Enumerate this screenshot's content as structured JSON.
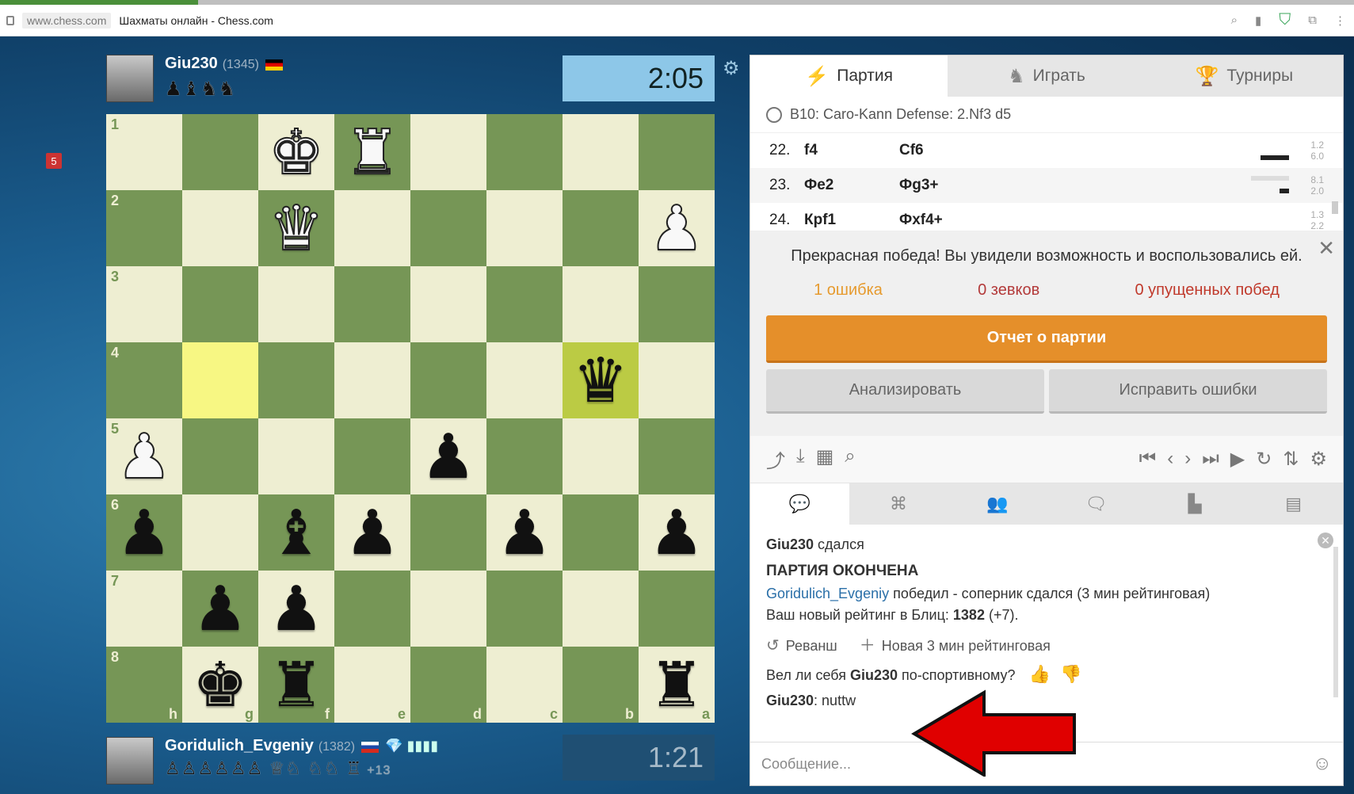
{
  "browser": {
    "host": "www.chess.com",
    "title": "Шахматы онлайн - Chess.com"
  },
  "top_player": {
    "name": "Giu230",
    "rating": "(1345)",
    "captured": "♟♝♞♞"
  },
  "bottom_player": {
    "name": "Goridulich_Evgeniy",
    "rating": "(1382)",
    "badges": "💎 ▮▮▮▮",
    "captured": "♙♙♙♙♙♙ ♕♘ ♘♘ ♖",
    "advantage": "+13"
  },
  "clocks": {
    "top": "2:05",
    "bottom": "1:21"
  },
  "sidebar_badge": "5",
  "board": {
    "ranks": [
      "1",
      "2",
      "3",
      "4",
      "5",
      "6",
      "7",
      "8"
    ],
    "files": [
      "h",
      "g",
      "f",
      "e",
      "d",
      "c",
      "b",
      "a"
    ],
    "pieces": [
      {
        "rank": 1,
        "col": 2,
        "glyph": "♚",
        "color": "w",
        "name": "white-king"
      },
      {
        "rank": 1,
        "col": 3,
        "glyph": "♜",
        "color": "w",
        "name": "white-rook"
      },
      {
        "rank": 2,
        "col": 2,
        "glyph": "♛",
        "color": "w",
        "name": "white-queen"
      },
      {
        "rank": 2,
        "col": 7,
        "glyph": "♟",
        "color": "w",
        "name": "white-pawn"
      },
      {
        "rank": 4,
        "col": 6,
        "glyph": "♛",
        "color": "b",
        "name": "black-queen"
      },
      {
        "rank": 5,
        "col": 0,
        "glyph": "♟",
        "color": "w",
        "name": "white-pawn"
      },
      {
        "rank": 5,
        "col": 4,
        "glyph": "♟",
        "color": "b",
        "name": "black-pawn"
      },
      {
        "rank": 6,
        "col": 0,
        "glyph": "♟",
        "color": "b",
        "name": "black-pawn"
      },
      {
        "rank": 6,
        "col": 2,
        "glyph": "♝",
        "color": "b",
        "name": "black-bishop"
      },
      {
        "rank": 6,
        "col": 3,
        "glyph": "♟",
        "color": "b",
        "name": "black-pawn"
      },
      {
        "rank": 6,
        "col": 5,
        "glyph": "♟",
        "color": "b",
        "name": "black-pawn"
      },
      {
        "rank": 6,
        "col": 7,
        "glyph": "♟",
        "color": "b",
        "name": "black-pawn"
      },
      {
        "rank": 7,
        "col": 1,
        "glyph": "♟",
        "color": "b",
        "name": "black-pawn"
      },
      {
        "rank": 7,
        "col": 2,
        "glyph": "♟",
        "color": "b",
        "name": "black-pawn"
      },
      {
        "rank": 8,
        "col": 1,
        "glyph": "♚",
        "color": "b",
        "name": "black-king"
      },
      {
        "rank": 8,
        "col": 2,
        "glyph": "♜",
        "color": "b",
        "name": "black-rook"
      },
      {
        "rank": 8,
        "col": 7,
        "glyph": "♜",
        "color": "b",
        "name": "black-rook"
      }
    ],
    "highlights": [
      {
        "rank": 4,
        "col": 1
      },
      {
        "rank": 4,
        "col": 6
      }
    ],
    "colors": {
      "light": "#eeeed2",
      "dark": "#769656"
    }
  },
  "tabs": [
    {
      "label": "Партия",
      "icon": "⚡"
    },
    {
      "label": "Играть",
      "icon": "♞"
    },
    {
      "label": "Турниры",
      "icon": "🏆"
    }
  ],
  "opening": "B10: Caro-Kann Defense: 2.Nf3 d5",
  "moves": [
    {
      "num": "22.",
      "white": "f4",
      "black": "Cf6",
      "t1": "1.2",
      "t2": "6.0"
    },
    {
      "num": "23.",
      "white": "Фe2",
      "black": "Фg3+",
      "t1": "8.1",
      "t2": "2.0"
    },
    {
      "num": "24.",
      "white": "Крf1",
      "black": "Фxf4+",
      "t1": "1.3",
      "t2": "2.2"
    }
  ],
  "result": {
    "message": "Прекрасная победа! Вы увидели возможность и воспользовались ей.",
    "mistakes": "1 ошибка",
    "blunders": "0 зевков",
    "missed": "0 упущенных побед",
    "report_button": "Отчет о партии",
    "analyze_button": "Анализировать",
    "fix_button": "Исправить ошибки"
  },
  "chat": {
    "resigned_user": "Giu230",
    "resigned_text": "сдался",
    "game_over": "ПАРТИЯ ОКОНЧЕНА",
    "winner": "Goridulich_Evgeniy",
    "winner_text": "победил - соперник сдался (3 мин рейтинговая)",
    "rating_text": "Ваш новый рейтинг в Блиц:",
    "rating_value": "1382",
    "rating_delta": "(+7).",
    "rematch": "Реванш",
    "new_game": "Новая 3 мин рейтинговая",
    "sport_q_pre": "Вел ли себя",
    "sport_q_user": "Giu230",
    "sport_q_post": "по-спортивному?",
    "msg_user": "Giu230",
    "msg_text": "nuttw",
    "placeholder": "Сообщение..."
  },
  "colors": {
    "accent": "#e58f2a",
    "board_light": "#eeeed2",
    "board_dark": "#769656",
    "arrow": "#e00000"
  }
}
